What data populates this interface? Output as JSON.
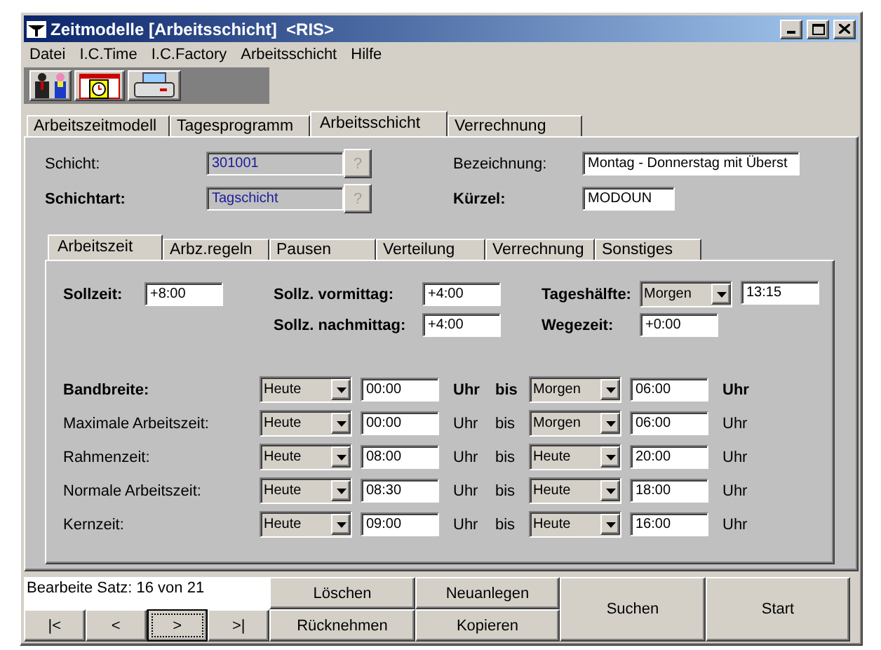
{
  "window": {
    "title": "Zeitmodelle [Arbeitsschicht]  <RIS>",
    "controls": [
      {
        "kind": "minimize"
      },
      {
        "kind": "maximize"
      },
      {
        "kind": "close"
      }
    ]
  },
  "menu": [
    {
      "label": "Datei"
    },
    {
      "label": "I.C.Time"
    },
    {
      "label": "I.C.Factory"
    },
    {
      "label": "Arbeitsschicht"
    },
    {
      "label": "Hilfe"
    }
  ],
  "toolbar": [
    {
      "kind": "people"
    },
    {
      "kind": "calendar"
    },
    {
      "kind": "printer"
    }
  ],
  "tabs": [
    {
      "label": "Arbeitszeitmodell",
      "selected": false
    },
    {
      "label": "Tagesprogramm",
      "selected": false
    },
    {
      "label": "Arbeitsschicht",
      "selected": true
    },
    {
      "label": "Verrechnung",
      "selected": false
    }
  ],
  "header": {
    "schicht": {
      "label": "Schicht:",
      "bold": false,
      "value": "301001",
      "button": "?"
    },
    "schichtart": {
      "label": "Schichtart:",
      "bold": true,
      "value": "Tagschicht",
      "button": "?"
    },
    "bezeichnung": {
      "label": "Bezeichnung:",
      "bold": false,
      "value": "Montag - Donnerstag mit Überst"
    },
    "kuerzel": {
      "label": "Kürzel:",
      "bold": true,
      "value": "MODOUN"
    }
  },
  "subtabs": [
    {
      "label": "Arbeitszeit",
      "selected": true
    },
    {
      "label": "Arbz.regeln",
      "selected": false
    },
    {
      "label": "Pausen",
      "selected": false
    },
    {
      "label": "Verteilung",
      "selected": false
    },
    {
      "label": "Verrechnung",
      "selected": false
    },
    {
      "label": "Sonstiges",
      "selected": false
    }
  ],
  "targets": {
    "sollzeit": {
      "label": "Sollzeit:",
      "value": "+8:00"
    },
    "vormittag": {
      "label": "Sollz. vormittag:",
      "value": "+4:00"
    },
    "nachmittag": {
      "label": "Sollz. nachmittag:",
      "value": "+4:00"
    },
    "tageshaelfte": {
      "label": "Tageshälfte:",
      "select": "Morgen",
      "value": "13:15"
    },
    "wegezeit": {
      "label": "Wegezeit:",
      "value": "+0:00"
    }
  },
  "ranges": [
    {
      "label": "Bandbreite:",
      "bold": true,
      "from_day": "Heute",
      "from": "00:00",
      "unit1": "Uhr",
      "to_word": "bis",
      "to_day": "Morgen",
      "to": "06:00",
      "unit2": "Uhr"
    },
    {
      "label": "Maximale Arbeitszeit:",
      "bold": false,
      "from_day": "Heute",
      "from": "00:00",
      "unit1": "Uhr",
      "to_word": "bis",
      "to_day": "Morgen",
      "to": "06:00",
      "unit2": "Uhr"
    },
    {
      "label": "Rahmenzeit:",
      "bold": false,
      "from_day": "Heute",
      "from": "08:00",
      "unit1": "Uhr",
      "to_word": "bis",
      "to_day": "Heute",
      "to": "20:00",
      "unit2": "Uhr"
    },
    {
      "label": "Normale Arbeitszeit:",
      "bold": false,
      "from_day": "Heute",
      "from": "08:30",
      "unit1": "Uhr",
      "to_word": "bis",
      "to_day": "Heute",
      "to": "18:00",
      "unit2": "Uhr"
    },
    {
      "label": "Kernzeit:",
      "bold": false,
      "from_day": "Heute",
      "from": "09:00",
      "unit1": "Uhr",
      "to_word": "bis",
      "to_day": "Heute",
      "to": "16:00",
      "unit2": "Uhr"
    }
  ],
  "status": "Bearbeite Satz: 16 von 21",
  "nav": [
    {
      "label": "|<",
      "focused": false
    },
    {
      "label": "<",
      "focused": false
    },
    {
      "label": ">",
      "focused": true
    },
    {
      "label": ">|",
      "focused": false
    }
  ],
  "actions": {
    "loeschen": "Löschen",
    "neuanlegen": "Neuanlegen",
    "ruecknehmen": "Rücknehmen",
    "kopieren": "Kopieren",
    "suchen": "Suchen",
    "start": "Start"
  }
}
